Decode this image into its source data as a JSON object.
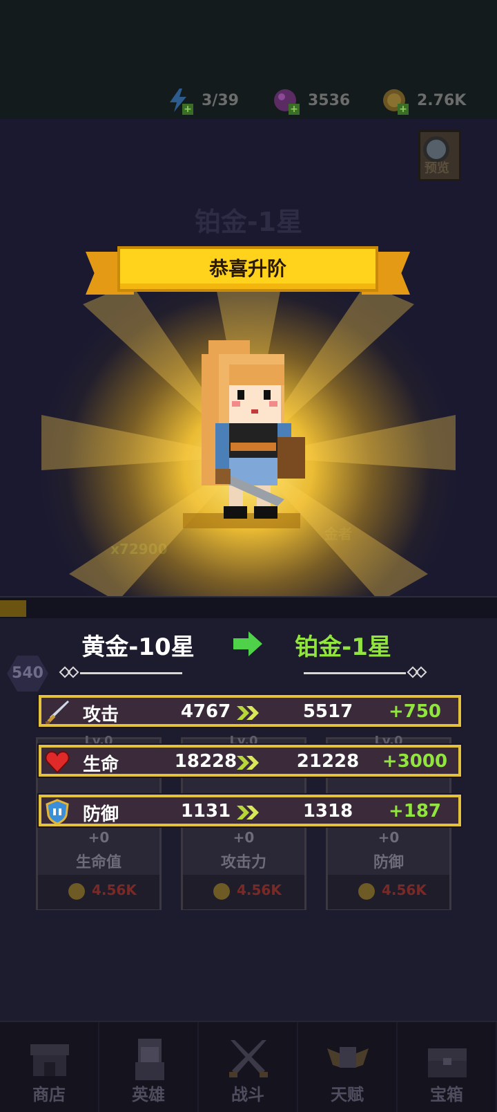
{
  "resources": {
    "energy": "3/39",
    "gems": "3536",
    "gold": "2.76K"
  },
  "preview_label": "预览",
  "dim_title": "铂金-1星",
  "banner_title": "恭喜升阶",
  "background": {
    "left_price": "x72900",
    "right_label": "金者",
    "level_badge": "540"
  },
  "rank": {
    "from": "黄金-10星",
    "to": "铂金-1星"
  },
  "stats": [
    {
      "icon": "sword-icon",
      "label": "攻击",
      "old": "4767",
      "new": "5517",
      "increase": "+750"
    },
    {
      "icon": "heart-icon",
      "label": "生命",
      "old": "18228",
      "new": "21228",
      "increase": "+3000"
    },
    {
      "icon": "shield-icon",
      "label": "防御",
      "old": "1131",
      "new": "1318",
      "increase": "+187"
    }
  ],
  "upgrade_cards": [
    {
      "level": "Lv.0",
      "bonus": "+0",
      "name": "生命值",
      "cost": "4.56K"
    },
    {
      "level": "Lv.0",
      "bonus": "+0",
      "name": "攻击力",
      "cost": "4.56K"
    },
    {
      "level": "Lv.0",
      "bonus": "+0",
      "name": "防御",
      "cost": "4.56K"
    }
  ],
  "nav": [
    {
      "label": "商店",
      "icon": "shop-icon"
    },
    {
      "label": "英雄",
      "icon": "hero-icon"
    },
    {
      "label": "战斗",
      "icon": "swords-icon"
    },
    {
      "label": "天赋",
      "icon": "talent-icon"
    },
    {
      "label": "宝箱",
      "icon": "chest-icon"
    }
  ],
  "colors": {
    "gold_border": "#e3c33d",
    "increase_green": "#92e43f",
    "banner_yellow": "#ffd21b"
  }
}
